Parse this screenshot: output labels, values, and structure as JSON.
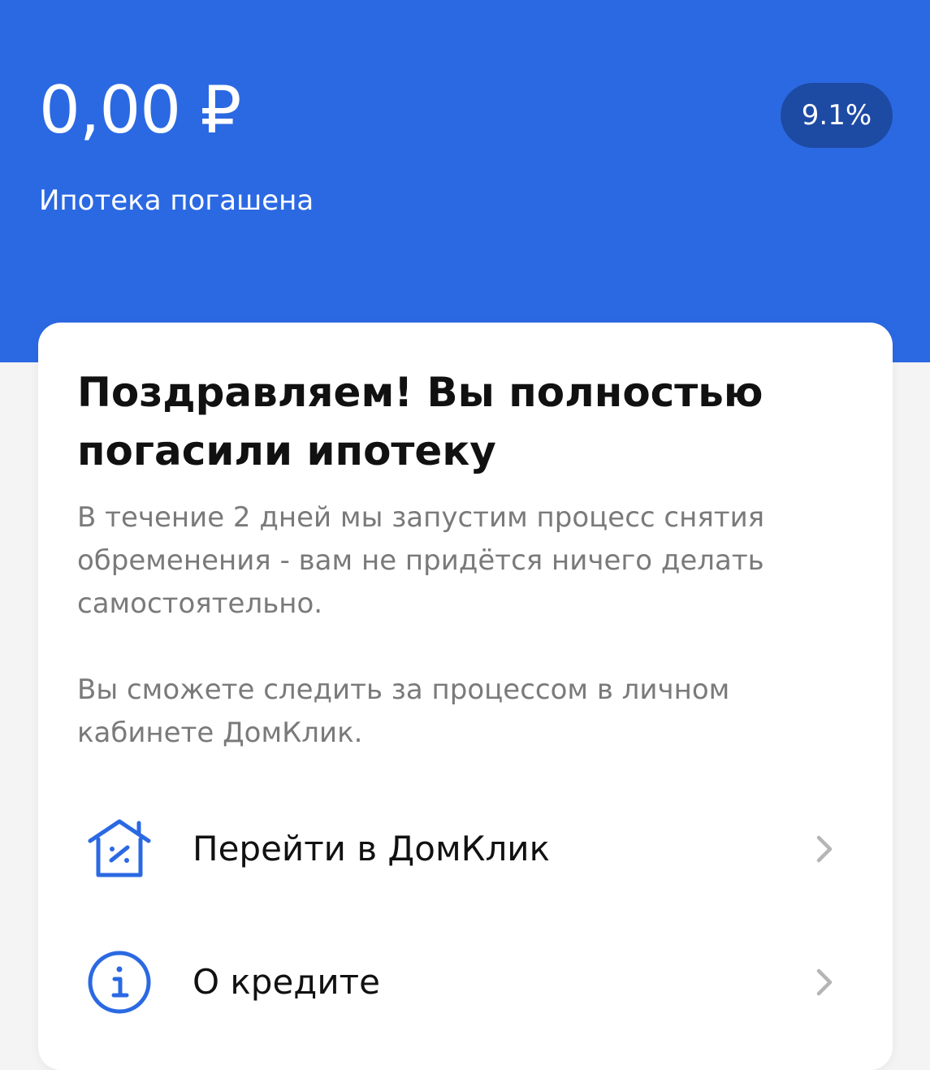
{
  "header": {
    "balance": "0,00 ₽",
    "status": "Ипотека погашена",
    "rate_badge": "9.1%"
  },
  "card": {
    "title": "Поздравляем! Вы полностью погасили ипотеку",
    "paragraph_1": "В течение 2 дней мы запустим процесс снятия обременения - вам не придётся ничего делать самостоятельно.",
    "paragraph_2": "Вы сможете следить за процессом в личном кабинете ДомКлик.",
    "menu": [
      {
        "label": "Перейти в ДомКлик",
        "icon": "house-percent-icon"
      },
      {
        "label": "О кредите",
        "icon": "info-icon"
      }
    ]
  },
  "colors": {
    "header_bg": "#2b69e3",
    "badge_bg": "#1d4aa3",
    "icon_accent": "#2b69e3",
    "page_bg": "#f4f4f5"
  }
}
